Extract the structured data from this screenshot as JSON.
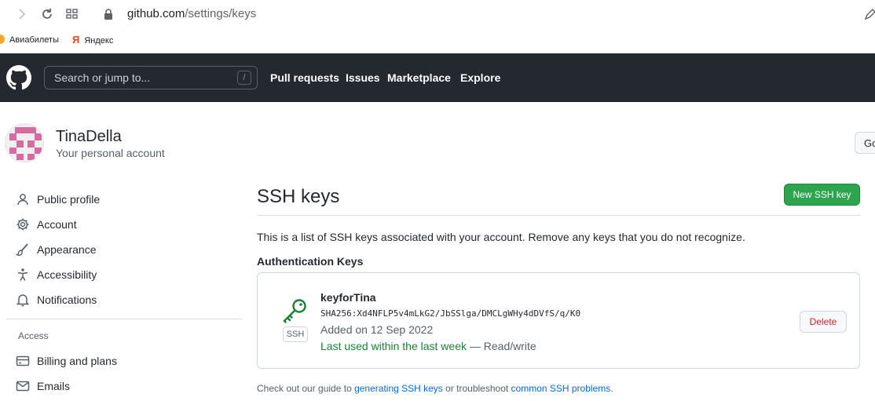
{
  "browser": {
    "url_domain": "github.com",
    "url_path": "/settings/keys",
    "bookmarks": [
      "Авиабилеты",
      "Яндекс"
    ]
  },
  "header": {
    "search_placeholder": "Search or jump to...",
    "search_shortcut": "/",
    "nav": [
      "Pull requests",
      "Issues",
      "Marketplace",
      "Explore"
    ]
  },
  "account": {
    "username": "TinaDella",
    "subtitle": "Your personal account",
    "go_button": "Go"
  },
  "sidebar": {
    "items": [
      {
        "label": "Public profile",
        "icon": "person-icon"
      },
      {
        "label": "Account",
        "icon": "gear-icon"
      },
      {
        "label": "Appearance",
        "icon": "paintbrush-icon"
      },
      {
        "label": "Accessibility",
        "icon": "accessibility-icon"
      },
      {
        "label": "Notifications",
        "icon": "bell-icon"
      }
    ],
    "section_heading": "Access",
    "access_items": [
      {
        "label": "Billing and plans",
        "icon": "credit-card-icon"
      },
      {
        "label": "Emails",
        "icon": "mail-icon"
      }
    ]
  },
  "main": {
    "title": "SSH keys",
    "new_key_button": "New SSH key",
    "intro": "This is a list of SSH keys associated with your account. Remove any keys that you do not recognize.",
    "auth_heading": "Authentication Keys",
    "key": {
      "badge": "SSH",
      "name": "keyforTina",
      "fingerprint": "SHA256:Xd4NFLP5v4mLkG2/JbSSlga/DMCLgWHy4dDVfS/q/K0",
      "added": "Added on 12 Sep 2022",
      "last_used": "Last used within the last week",
      "access": " — Read/write",
      "delete_button": "Delete"
    },
    "footer": {
      "prefix": "Check out our guide to ",
      "link1": "generating SSH keys",
      "middle": " or troubleshoot ",
      "link2": "common SSH problems",
      "suffix": "."
    }
  },
  "colors": {
    "header_bg": "#24292f",
    "primary_button": "#2da44e",
    "danger": "#cf222e",
    "link": "#0969da",
    "success_text": "#1a7f37"
  }
}
